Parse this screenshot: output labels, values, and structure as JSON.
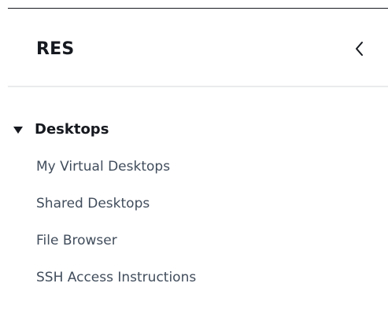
{
  "header": {
    "title": "RES",
    "collapse_icon": "chevron-left-icon"
  },
  "nav": {
    "section": {
      "label": "Desktops",
      "expanded": true,
      "caret_icon": "caret-down-icon"
    },
    "items": [
      {
        "label": "My Virtual Desktops"
      },
      {
        "label": "Shared Desktops"
      },
      {
        "label": "File Browser"
      },
      {
        "label": "SSH Access Instructions"
      }
    ]
  },
  "colors": {
    "text": "#16191f",
    "link": "#414d5c",
    "divider": "#e9ebed"
  }
}
